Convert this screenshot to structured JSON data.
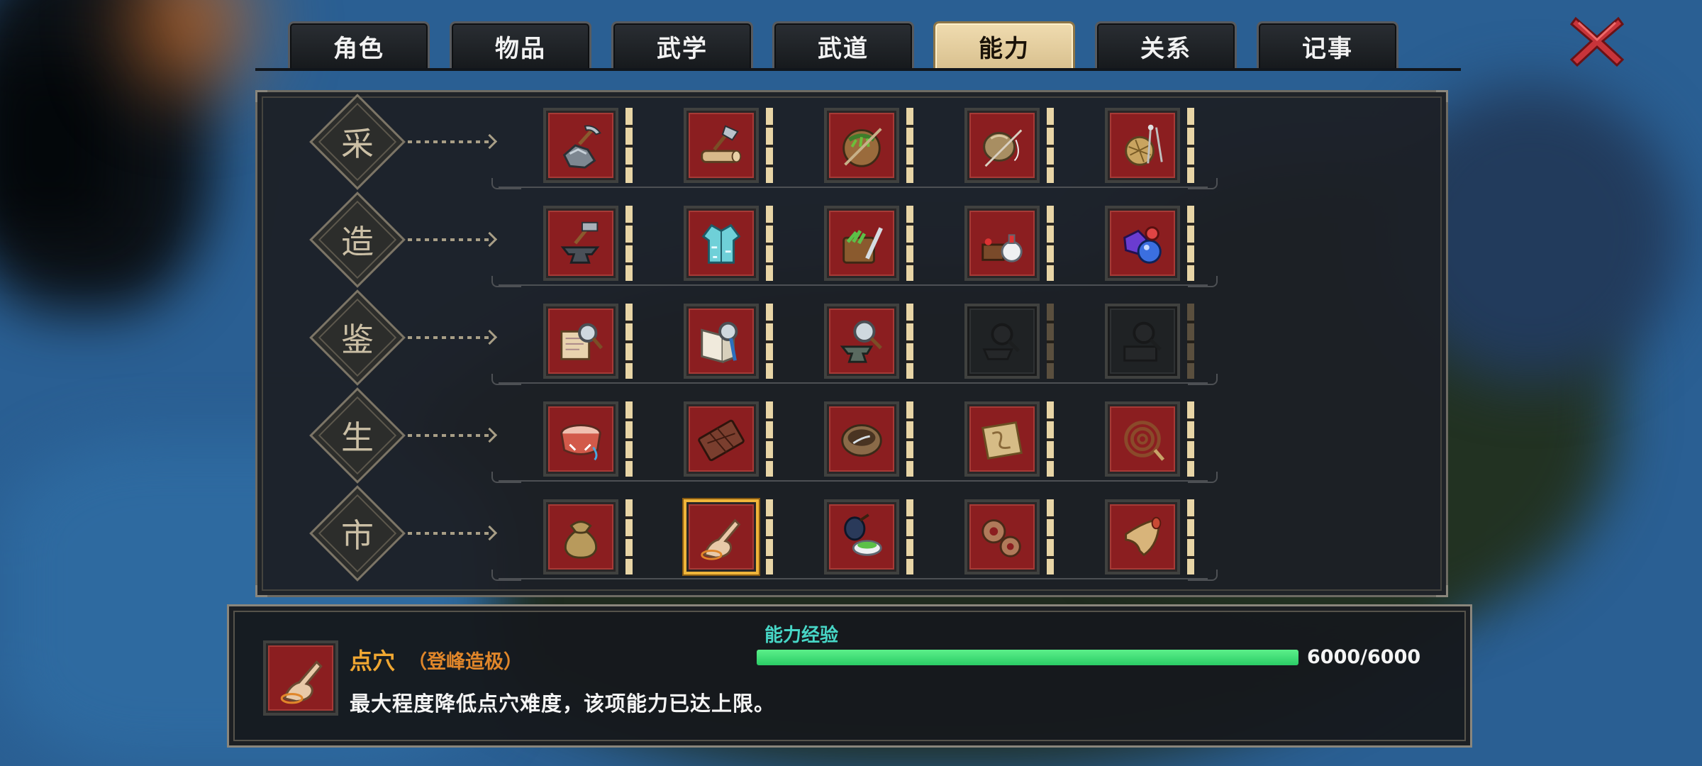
{
  "tabs": [
    {
      "label": "角色",
      "active": false
    },
    {
      "label": "物品",
      "active": false
    },
    {
      "label": "武学",
      "active": false
    },
    {
      "label": "武道",
      "active": false
    },
    {
      "label": "能力",
      "active": true
    },
    {
      "label": "关系",
      "active": false
    },
    {
      "label": "记事",
      "active": false
    }
  ],
  "close_icon": "close-x-icon",
  "categories": [
    {
      "label": "采",
      "skills": [
        {
          "icon": "ore-pickaxe-icon",
          "locked": false
        },
        {
          "icon": "wood-axe-icon",
          "locked": false
        },
        {
          "icon": "herb-basket-icon",
          "locked": false
        },
        {
          "icon": "fishing-rod-icon",
          "locked": false
        },
        {
          "icon": "yarn-spindle-icon",
          "locked": false
        }
      ]
    },
    {
      "label": "造",
      "skills": [
        {
          "icon": "anvil-hammer-icon",
          "locked": false
        },
        {
          "icon": "tailoring-robe-icon",
          "locked": false
        },
        {
          "icon": "herb-cutting-board-icon",
          "locked": false
        },
        {
          "icon": "alchemy-bottles-icon",
          "locked": false
        },
        {
          "icon": "gemstones-icon",
          "locked": false
        }
      ]
    },
    {
      "label": "鉴",
      "skills": [
        {
          "icon": "scroll-magnifier-icon",
          "locked": false
        },
        {
          "icon": "book-magnifier-icon",
          "locked": false
        },
        {
          "icon": "anvil-magnifier-icon",
          "locked": false
        },
        {
          "icon": "furnace-magnifier-icon",
          "locked": true
        },
        {
          "icon": "box-magnifier-icon",
          "locked": true
        }
      ]
    },
    {
      "label": "生",
      "skills": [
        {
          "icon": "drum-icon",
          "locked": false
        },
        {
          "icon": "chocolate-plank-icon",
          "locked": false
        },
        {
          "icon": "cooking-pot-icon",
          "locked": false
        },
        {
          "icon": "map-parchment-icon",
          "locked": false
        },
        {
          "icon": "coiled-whip-icon",
          "locked": false
        }
      ]
    },
    {
      "label": "市",
      "skills": [
        {
          "icon": "money-bag-icon",
          "locked": false
        },
        {
          "icon": "finger-point-icon",
          "locked": false,
          "selected": true
        },
        {
          "icon": "tea-cup-icon",
          "locked": false
        },
        {
          "icon": "gears-icon",
          "locked": false
        },
        {
          "icon": "horn-icon",
          "locked": false
        }
      ]
    }
  ],
  "info": {
    "icon": "finger-point-icon",
    "name": "点穴",
    "rank": "（登峰造极）",
    "description": "最大程度降低点穴难度，该项能力已达上限。",
    "exp_label": "能力经验",
    "exp_value": "6000/6000",
    "exp_fraction": 1.0
  },
  "colors": {
    "active_tab": "#e4ccA0",
    "skill_bg": "#8b1e20",
    "exp_bar": "#2bcc66",
    "name_color": "#f0a732",
    "exp_label_color": "#47d6c6"
  }
}
